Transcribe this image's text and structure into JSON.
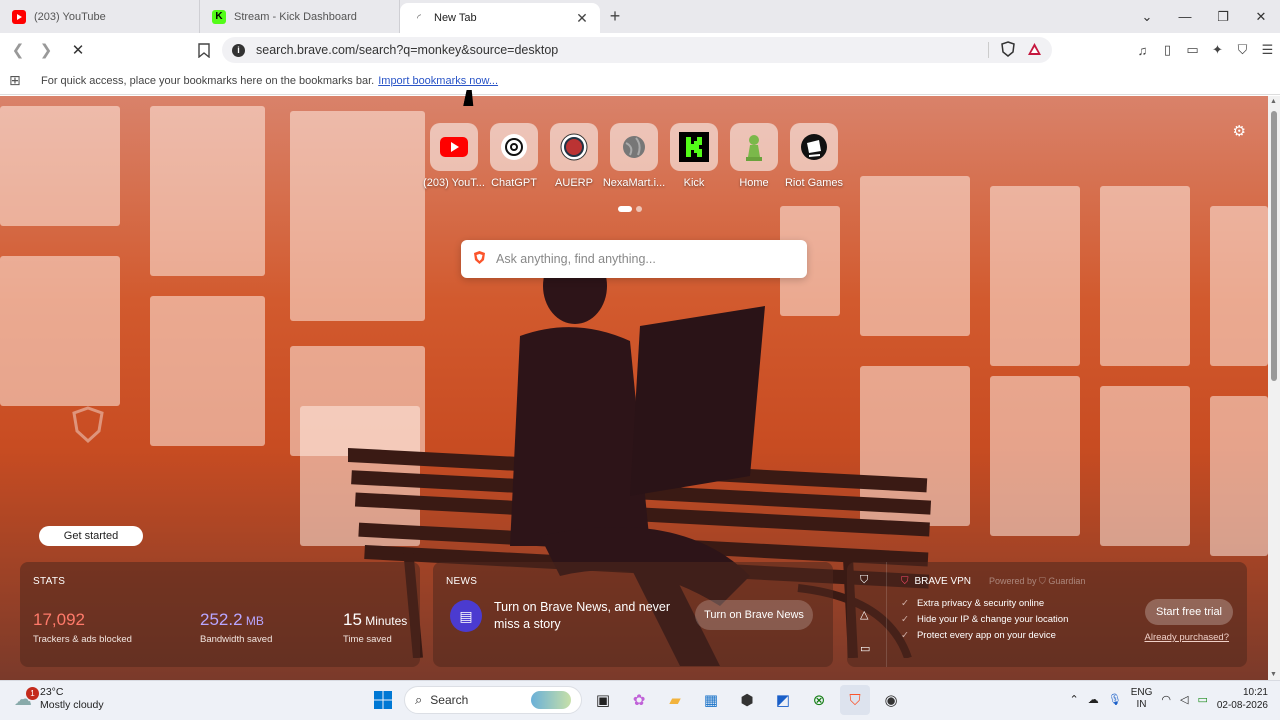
{
  "tabs": [
    {
      "label": "(203) YouTube",
      "favicon_color": "#ff0000",
      "active": false
    },
    {
      "label": "Stream - Kick Dashboard",
      "favicon_color": "#53fc18",
      "active": false
    },
    {
      "label": "New Tab",
      "favicon_color": "#ffffff",
      "active": true
    }
  ],
  "window_controls": {
    "dropdown": "⌄",
    "minimize": "—",
    "restore": "❐",
    "close": "✕"
  },
  "address_bar": {
    "url": "search.brave.com/search?q=monkey&source=desktop"
  },
  "bookmarks_bar": {
    "message": "For quick access, place your bookmarks here on the bookmarks bar.",
    "import_link": "Import bookmarks now..."
  },
  "shortcuts": [
    {
      "label": "(203) YouT...",
      "icon": "youtube-icon"
    },
    {
      "label": "ChatGPT",
      "icon": "chatgpt-icon"
    },
    {
      "label": "AUERP",
      "icon": "auerp-icon"
    },
    {
      "label": "NexaMart.i...",
      "icon": "globe-icon"
    },
    {
      "label": "Kick",
      "icon": "kick-icon"
    },
    {
      "label": "Home",
      "icon": "chess-pawn-icon"
    },
    {
      "label": "Riot Games",
      "icon": "riot-icon"
    }
  ],
  "search": {
    "placeholder": "Ask anything, find anything..."
  },
  "promo": {
    "button": "Get started"
  },
  "stats": {
    "title": "STATS",
    "trackers": {
      "value": "17,092",
      "label": "Trackers & ads blocked",
      "color": "#ff7a6a"
    },
    "bandwidth": {
      "value": "252.2",
      "unit": "MB",
      "label": "Bandwidth saved",
      "color": "#b8a6ff"
    },
    "time": {
      "value": "15",
      "unit": "Minutes",
      "label": "Time saved"
    }
  },
  "news": {
    "title": "NEWS",
    "text": "Turn on Brave News, and never miss a story",
    "button": "Turn on Brave News"
  },
  "vpn": {
    "title": "BRAVE VPN",
    "powered_by": "Powered by",
    "powered_name": "Guardian",
    "features": [
      "Extra privacy & security online",
      "Hide your IP & change your location",
      "Protect every app on your device"
    ],
    "button": "Start free trial",
    "link": "Already purchased?"
  },
  "taskbar": {
    "weather_temp": "23°C",
    "weather_desc": "Mostly cloudy",
    "weather_badge": "1",
    "search_label": "Search",
    "lang_top": "ENG",
    "lang_bottom": "IN",
    "time": "10:21",
    "date": "02-08-2026"
  }
}
